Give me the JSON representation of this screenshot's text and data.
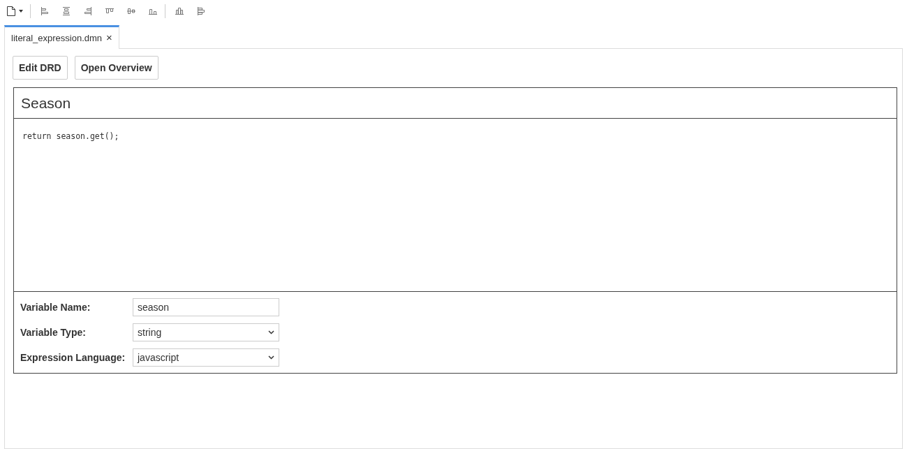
{
  "tabs": [
    {
      "label": "literal_expression.dmn",
      "close": "×",
      "selected": true
    }
  ],
  "buttons": [
    "Edit DRD",
    "Open Overview"
  ],
  "expression": {
    "title": "Season",
    "code": "return season.get();"
  },
  "fields": [
    {
      "label": "Variable Name:",
      "kind": "text",
      "value": "season"
    },
    {
      "label": "Variable Type:",
      "kind": "select",
      "value": "string"
    },
    {
      "label": "Expression Language:",
      "kind": "select",
      "value": "javascript"
    }
  ]
}
